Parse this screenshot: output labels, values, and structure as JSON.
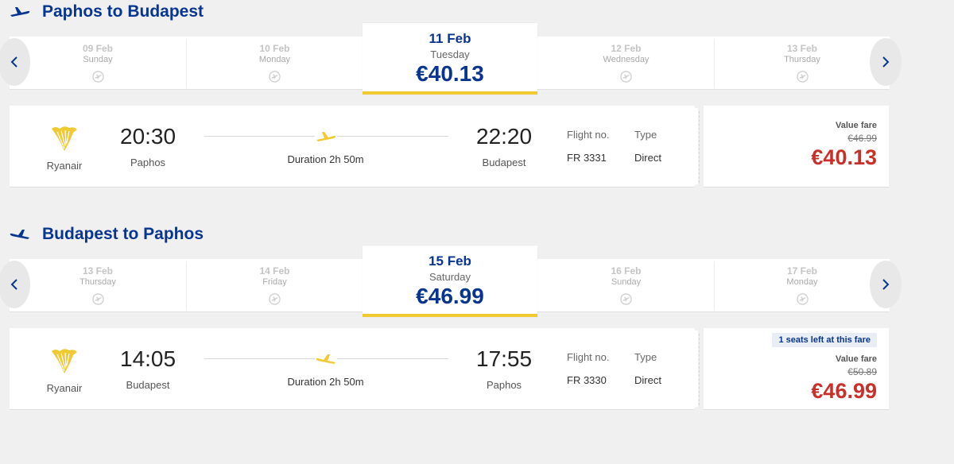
{
  "colors": {
    "brand_blue": "#073590",
    "accent_yellow": "#f1c933",
    "price_red": "#c8302b"
  },
  "outbound": {
    "title": "Paphos to Budapest",
    "dates": [
      {
        "date": "09 Feb",
        "weekday": "Sunday"
      },
      {
        "date": "10 Feb",
        "weekday": "Monday"
      },
      {
        "date": "11 Feb",
        "weekday": "Tuesday",
        "price": "€40.13",
        "selected": true
      },
      {
        "date": "12 Feb",
        "weekday": "Wednesday"
      },
      {
        "date": "13 Feb",
        "weekday": "Thursday"
      }
    ],
    "flight": {
      "airline": "Ryanair",
      "depart_time": "20:30",
      "depart_city": "Paphos",
      "duration": "Duration 2h 50m",
      "arrive_time": "22:20",
      "arrive_city": "Budapest",
      "flight_no_label": "Flight no.",
      "flight_no": "FR 3331",
      "type_label": "Type",
      "type": "Direct"
    },
    "fare": {
      "label": "Value fare",
      "old_price": "€46.99",
      "price": "€40.13"
    }
  },
  "inbound": {
    "title": "Budapest to Paphos",
    "dates": [
      {
        "date": "13 Feb",
        "weekday": "Thursday"
      },
      {
        "date": "14 Feb",
        "weekday": "Friday"
      },
      {
        "date": "15 Feb",
        "weekday": "Saturday",
        "price": "€46.99",
        "selected": true
      },
      {
        "date": "16 Feb",
        "weekday": "Sunday"
      },
      {
        "date": "17 Feb",
        "weekday": "Monday"
      }
    ],
    "flight": {
      "airline": "Ryanair",
      "depart_time": "14:05",
      "depart_city": "Budapest",
      "duration": "Duration 2h 50m",
      "arrive_time": "17:55",
      "arrive_city": "Paphos",
      "flight_no_label": "Flight no.",
      "flight_no": "FR 3330",
      "type_label": "Type",
      "type": "Direct"
    },
    "fare": {
      "seats_badge": "1 seats left at this fare",
      "label": "Value fare",
      "old_price": "€50.89",
      "price": "€46.99"
    }
  }
}
